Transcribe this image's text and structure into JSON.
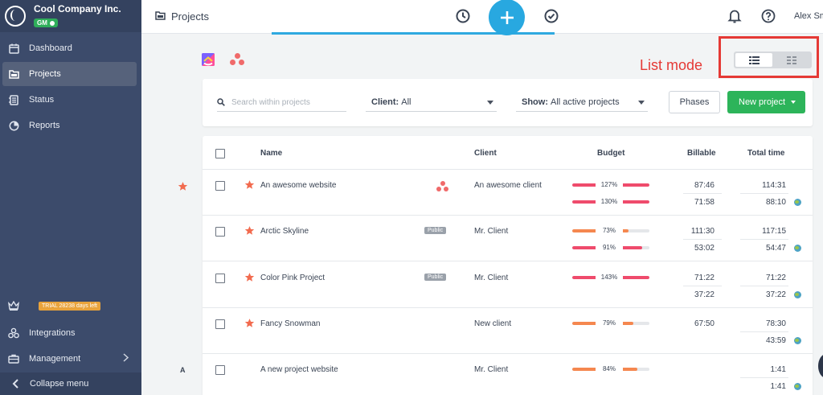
{
  "sidebar": {
    "company_name": "Cool Company Inc.",
    "badge": "GM",
    "nav": [
      {
        "label": "Dashboard",
        "icon": "calendar-icon"
      },
      {
        "label": "Projects",
        "icon": "folder-icon",
        "active": true
      },
      {
        "label": "Status",
        "icon": "status-icon"
      },
      {
        "label": "Reports",
        "icon": "pie-chart-icon"
      }
    ],
    "trial_badge": "TRIAL 28238 days left",
    "bottom_nav": [
      {
        "label": "Integrations",
        "icon": "integrations-icon"
      },
      {
        "label": "Management",
        "icon": "briefcase-icon"
      }
    ],
    "collapse_label": "Collapse menu"
  },
  "header": {
    "title": "Projects",
    "user_name": "Alex Sm",
    "accent_color": "#28a8e0"
  },
  "annotation": {
    "label": "List mode",
    "color": "#e53935"
  },
  "filters": {
    "search_placeholder": "Search within projects",
    "client_label": "Client:",
    "client_value": "All",
    "show_label": "Show:",
    "show_value": "All active projects",
    "phases_label": "Phases",
    "new_project_label": "New project"
  },
  "table": {
    "columns": {
      "name": "Name",
      "client": "Client",
      "budget": "Budget",
      "billable": "Billable",
      "total": "Total time"
    },
    "rows": [
      {
        "name": "An awesome website",
        "starred": true,
        "public": false,
        "asana": true,
        "client": "An awesome client",
        "budget": [
          {
            "pct": "127%",
            "ratio": 1.0,
            "color": "#ef4b6c"
          },
          {
            "pct": "130%",
            "ratio": 1.0,
            "color": "#ef4b6c"
          }
        ],
        "billable": [
          "87:46",
          "71:58"
        ],
        "total": [
          "114:31",
          "88:10"
        ]
      },
      {
        "name": "Arctic Skyline",
        "starred": true,
        "public": true,
        "public_label": "Public",
        "asana": false,
        "client": "Mr. Client",
        "budget": [
          {
            "pct": "73%",
            "ratio": 0.73,
            "color": "#f5874f"
          },
          {
            "pct": "91%",
            "ratio": 0.91,
            "color": "#ef4b6c"
          }
        ],
        "billable": [
          "111:30",
          "53:02"
        ],
        "total": [
          "117:15",
          "54:47"
        ]
      },
      {
        "name": "Color Pink Project",
        "starred": true,
        "public": true,
        "public_label": "Public",
        "asana": false,
        "client": "Mr. Client",
        "budget": [
          {
            "pct": "143%",
            "ratio": 1.0,
            "color": "#ef4b6c"
          }
        ],
        "billable": [
          "71:22",
          "37:22"
        ],
        "total": [
          "71:22",
          "37:22"
        ]
      },
      {
        "name": "Fancy Snowman",
        "starred": true,
        "public": false,
        "asana": false,
        "client": "New client",
        "budget": [
          {
            "pct": "79%",
            "ratio": 0.79,
            "color": "#f5874f"
          }
        ],
        "billable": [
          "67:50"
        ],
        "total": [
          "78:30",
          "43:59"
        ]
      },
      {
        "name": "A new project website",
        "starred": false,
        "public": false,
        "asana": false,
        "client": "Mr. Client",
        "budget": [
          {
            "pct": "84%",
            "ratio": 0.84,
            "color": "#f5874f"
          }
        ],
        "billable": [],
        "total": [
          "1:41",
          "1:41"
        ]
      }
    ],
    "group_letter": "A"
  }
}
